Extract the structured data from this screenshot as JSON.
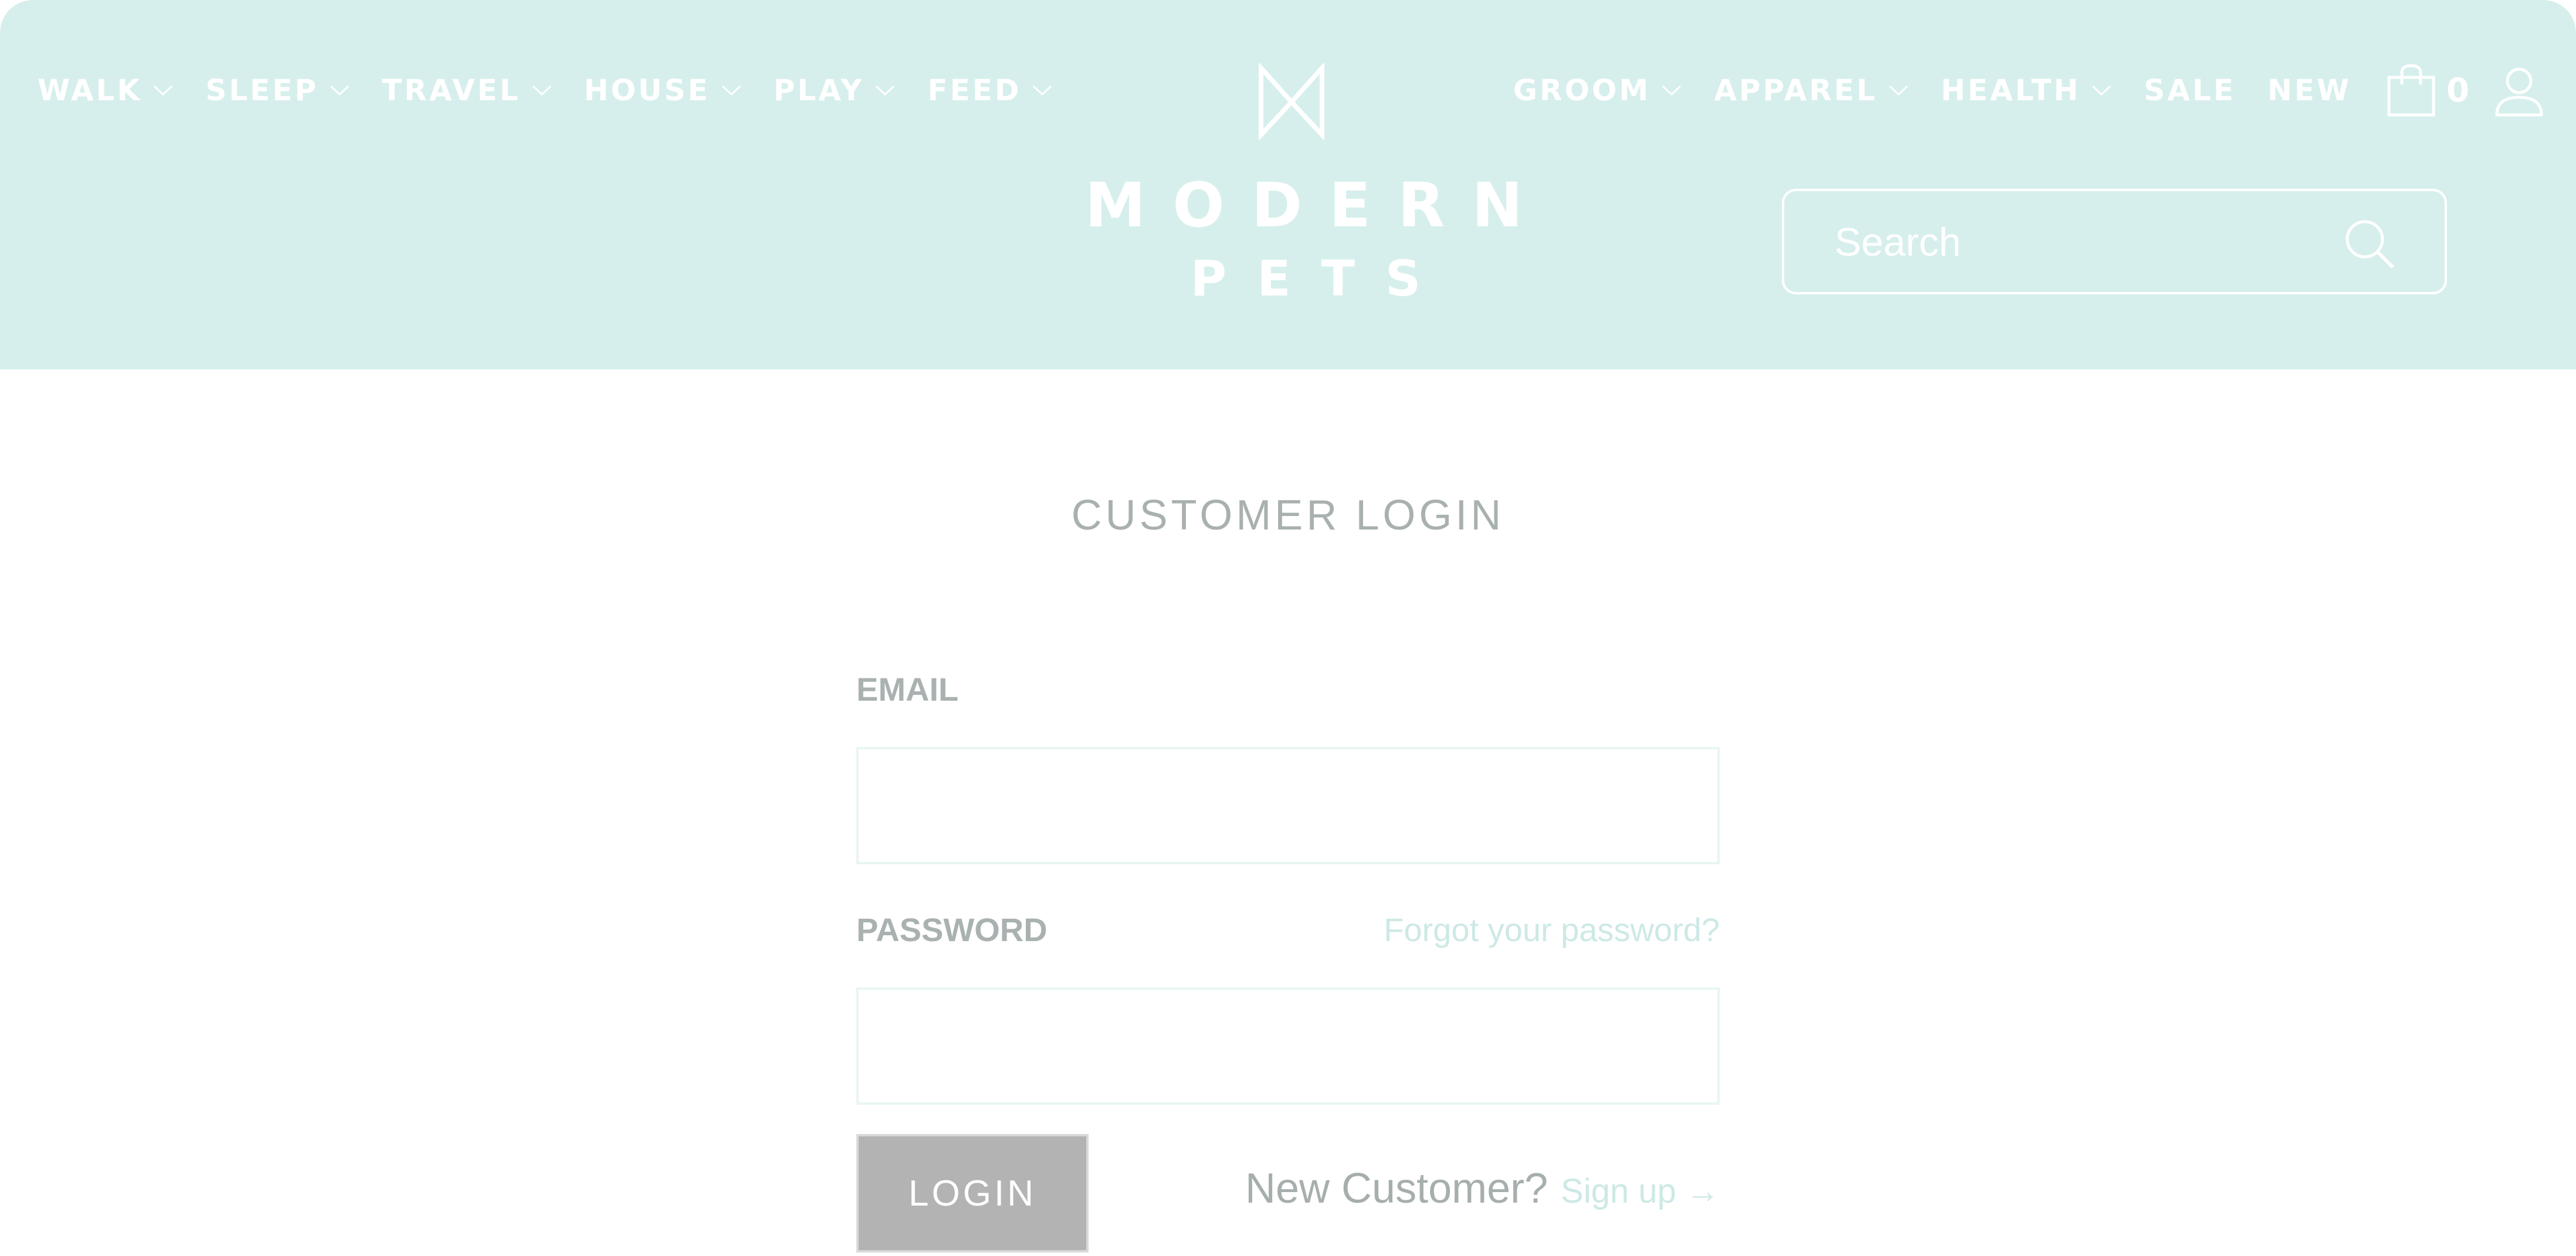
{
  "header": {
    "nav_left": [
      {
        "label": "WALK",
        "has_dropdown": true
      },
      {
        "label": "SLEEP",
        "has_dropdown": true
      },
      {
        "label": "TRAVEL",
        "has_dropdown": true
      },
      {
        "label": "HOUSE",
        "has_dropdown": true
      },
      {
        "label": "PLAY",
        "has_dropdown": true
      },
      {
        "label": "FEED",
        "has_dropdown": true
      }
    ],
    "nav_right": [
      {
        "label": "GROOM",
        "has_dropdown": true
      },
      {
        "label": "APPAREL",
        "has_dropdown": true
      },
      {
        "label": "HEALTH",
        "has_dropdown": true
      },
      {
        "label": "SALE",
        "has_dropdown": false
      },
      {
        "label": "NEW",
        "has_dropdown": false
      }
    ],
    "cart_count": "0",
    "logo": {
      "line1": "MODERN",
      "line2": "PETS"
    },
    "search": {
      "placeholder": "Search"
    },
    "icons": {
      "dropdown": "chevron-down-icon",
      "cart": "shopping-bag-icon",
      "account": "user-icon",
      "search": "search-icon",
      "logo_mark": "bowtie-logo-icon"
    }
  },
  "login": {
    "title": "CUSTOMER LOGIN",
    "email_label": "EMAIL",
    "email_value": "",
    "password_label": "PASSWORD",
    "password_value": "",
    "forgot_link": "Forgot your password?",
    "login_button": "LOGIN",
    "new_customer_text": "New Customer?",
    "signup_link": "Sign up →"
  },
  "colors": {
    "header_bg": "#d6efec",
    "header_text": "#ffffff",
    "accent_link": "#cde9e6",
    "muted_text": "#a9b0b0",
    "button_bg": "#b3b3b3"
  }
}
